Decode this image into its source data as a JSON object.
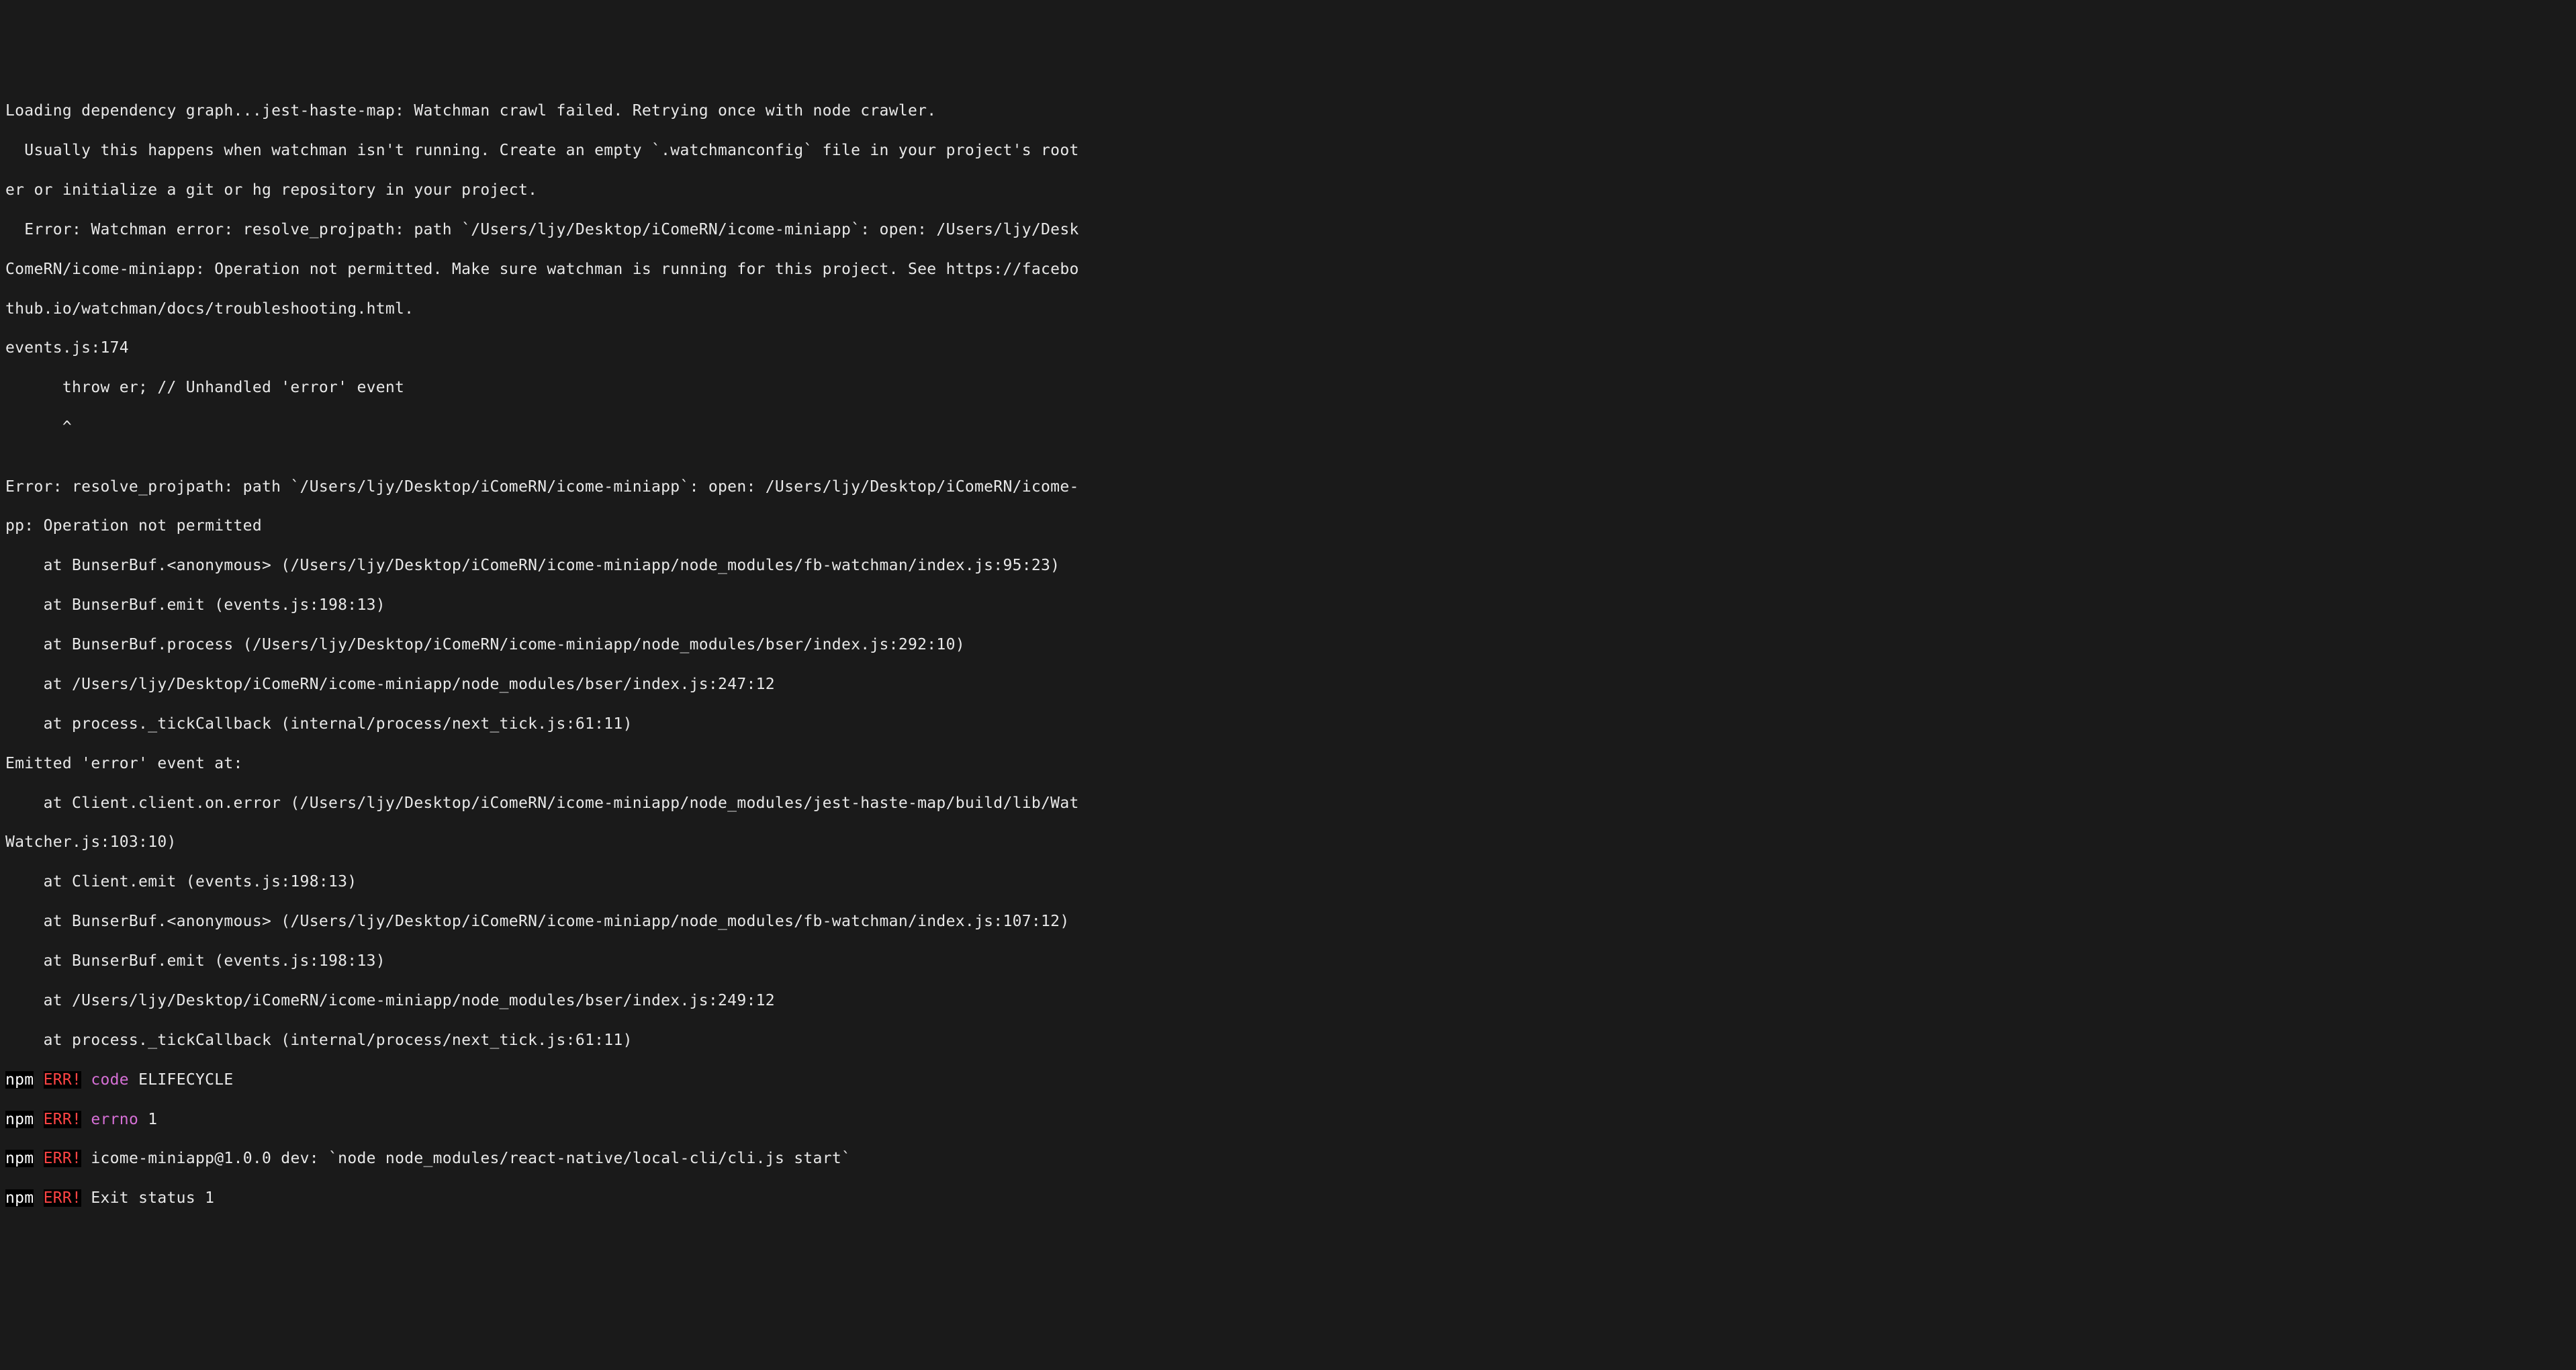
{
  "lines": [
    "Loading dependency graph...jest-haste-map: Watchman crawl failed. Retrying once with node crawler.",
    "  Usually this happens when watchman isn't running. Create an empty `.watchmanconfig` file in your project's root",
    "er or initialize a git or hg repository in your project.",
    "  Error: Watchman error: resolve_projpath: path `/Users/ljy/Desktop/iComeRN/icome-miniapp`: open: /Users/ljy/Desk",
    "ComeRN/icome-miniapp: Operation not permitted. Make sure watchman is running for this project. See https://facebo",
    "thub.io/watchman/docs/troubleshooting.html.",
    "events.js:174",
    "      throw er; // Unhandled 'error' event",
    "      ^",
    "",
    "Error: resolve_projpath: path `/Users/ljy/Desktop/iComeRN/icome-miniapp`: open: /Users/ljy/Desktop/iComeRN/icome-",
    "pp: Operation not permitted",
    "    at BunserBuf.<anonymous> (/Users/ljy/Desktop/iComeRN/icome-miniapp/node_modules/fb-watchman/index.js:95:23)",
    "    at BunserBuf.emit (events.js:198:13)",
    "    at BunserBuf.process (/Users/ljy/Desktop/iComeRN/icome-miniapp/node_modules/bser/index.js:292:10)",
    "    at /Users/ljy/Desktop/iComeRN/icome-miniapp/node_modules/bser/index.js:247:12",
    "    at process._tickCallback (internal/process/next_tick.js:61:11)",
    "Emitted 'error' event at:",
    "    at Client.client.on.error (/Users/ljy/Desktop/iComeRN/icome-miniapp/node_modules/jest-haste-map/build/lib/Wat",
    "Watcher.js:103:10)",
    "    at Client.emit (events.js:198:13)",
    "    at BunserBuf.<anonymous> (/Users/ljy/Desktop/iComeRN/icome-miniapp/node_modules/fb-watchman/index.js:107:12)",
    "    at BunserBuf.emit (events.js:198:13)",
    "    at /Users/ljy/Desktop/iComeRN/icome-miniapp/node_modules/bser/index.js:249:12",
    "    at process._tickCallback (internal/process/next_tick.js:61:11)"
  ],
  "npm_errors": [
    {
      "prefix": "npm",
      "err": "ERR!",
      "key": "code",
      "value": "ELIFECYCLE"
    },
    {
      "prefix": "npm",
      "err": "ERR!",
      "key": "errno",
      "value": "1"
    },
    {
      "prefix": "npm",
      "err": "ERR!",
      "key": "",
      "value": "icome-miniapp@1.0.0 dev: `node node_modules/react-native/local-cli/cli.js start`"
    },
    {
      "prefix": "npm",
      "err": "ERR!",
      "key": "",
      "value": "Exit status 1"
    }
  ]
}
